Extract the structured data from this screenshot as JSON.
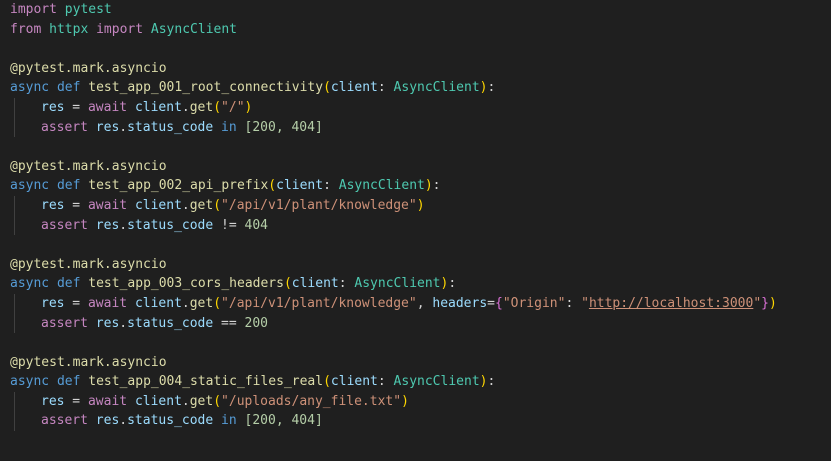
{
  "code": {
    "l1": {
      "kw": "import",
      "mod": "pytest"
    },
    "l2": {
      "kw_from": "from",
      "mod": "httpx",
      "kw_import": "import",
      "cls": "AsyncClient"
    },
    "dec": "@pytest.mark.asyncio",
    "async": "async",
    "def": "def",
    "await": "await",
    "assert": "assert",
    "in": "in",
    "t1": {
      "name": "test_app_001_root_connectivity",
      "param": "client",
      "type": "AsyncClient",
      "url": "\"/\"",
      "check": "[200, 404]"
    },
    "t2": {
      "name": "test_app_002_api_prefix",
      "param": "client",
      "type": "AsyncClient",
      "url": "\"/api/v1/plant/knowledge\"",
      "op": "!=",
      "code": "404"
    },
    "t3": {
      "name": "test_app_003_cors_headers",
      "param": "client",
      "type": "AsyncClient",
      "url": "\"/api/v1/plant/knowledge\"",
      "headers_kw": "headers",
      "hkey": "\"Origin\"",
      "hval": "http://localhost:3000",
      "op": "==",
      "code": "200"
    },
    "t4": {
      "name": "test_app_004_static_files_real",
      "param": "client",
      "type": "AsyncClient",
      "url": "\"/uploads/any_file.txt\"",
      "check": "[200, 404]"
    },
    "res": "res",
    "client_obj": "client",
    "get": "get",
    "status_code": "status_code"
  }
}
